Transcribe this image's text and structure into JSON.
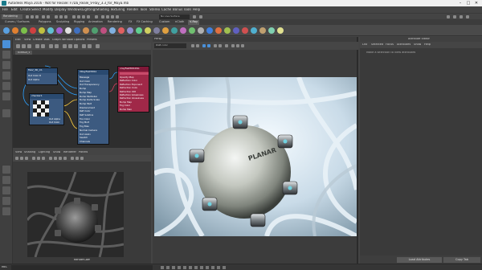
{
  "window": {
    "title": "Autodesk Maya 2016 - Not for Resale: F:/Da_Reale_V-Ray_3.3_for_Maya.mb"
  },
  "menubar": {
    "items": [
      "File",
      "Edit",
      "Create",
      "Select",
      "Modify",
      "Display",
      "Windows",
      "Lighting/Shading",
      "Texturing",
      "Render",
      "Toon",
      "Stereo",
      "Cache",
      "Bonus Tools",
      "Help"
    ]
  },
  "statusline": {
    "mode": "Rendering",
    "field": "No Live Surface"
  },
  "shelf": {
    "tabs": [
      "Curves / Surfaces",
      "Polygons",
      "Sculpting",
      "Rigging",
      "Animation",
      "Rendering",
      "FX",
      "FX Caching",
      "Custom",
      "nCloth",
      "V-Ray"
    ],
    "active_tab": "V-Ray",
    "icon_colors": [
      "#5aa0e0",
      "#e08030",
      "#7cc04a",
      "#d04040",
      "#c0c040",
      "#60c0d0",
      "#a060d0",
      "#e0e0e0",
      "#4070c0",
      "#d09050",
      "#50a070",
      "#c05080",
      "#80b0e0",
      "#e06060",
      "#9090d0",
      "#60d090",
      "#d0d060",
      "#8080a0",
      "#e0a040",
      "#40a0a0",
      "#c070c0",
      "#70c070",
      "#b0b0b0",
      "#4080e0",
      "#e07040",
      "#a0c050",
      "#6060c0",
      "#d05050",
      "#50b0d0",
      "#c0a070",
      "#80d0b0",
      "#e0e090"
    ]
  },
  "node_editor": {
    "menu": [
      "Edit",
      "View",
      "Create",
      "Tabs",
      "Graph",
      "Window",
      "Options",
      "Presets"
    ],
    "tab": "Untitled_1",
    "nodes": {
      "uv": {
        "title": "fileV_3D_C1",
        "rows": [
          "Out Color R",
          "Out Alpha"
        ],
        "color": "#4a7ab0"
      },
      "checker": {
        "title": "checker1",
        "rows": [
          "Out Alpha",
          "Out Color"
        ],
        "color": "#4a7ab0"
      },
      "vray_mtl": {
        "title": "VRayFastSSS1",
        "rows": [
          "Message",
          "Out Color",
          "Out Transparency",
          "Bump",
          "Bump Map",
          "Bump Multiplier",
          "Bump Delta Scale",
          "Bump Mult",
          "Displacement",
          "Refl Color",
          "Refl Subdivs",
          "Fog Color",
          "Fog Mult",
          "Fog Bias",
          "Normal Camera",
          "Out Apply",
          "Swatch",
          "Channels"
        ],
        "color": "#4a7ab0"
      },
      "sg": {
        "title": "vrayFastSSS1SG",
        "rows": [
          "Opacity Map",
          "Reflection Color",
          "Reflection Exponent",
          "Refraction Color",
          "Refraction IOR",
          "Reflection Glossiness",
          "Refraction Glossiness",
          "Bump Map",
          "Fog Color",
          "Bump Map"
        ],
        "color": "#b03050"
      }
    }
  },
  "render_view": {
    "menu": [
      "View",
      "Shading",
      "Lighting",
      "Show",
      "Renderer",
      "Panels"
    ],
    "caption": "RenderCam"
  },
  "viewport": {
    "title": "Persp",
    "camera": "RGB color"
  },
  "attribute_editor": {
    "title": "Attribute Editor",
    "tabs": [
      "List",
      "Selected",
      "Focus",
      "Attributes",
      "Show",
      "Help"
    ],
    "hint": "Make a selection to view attributes",
    "buttons": [
      "Load Attributes",
      "Copy Tab"
    ]
  },
  "bottombar": {
    "label": "MEL"
  },
  "render": {
    "brand": "PLANAR"
  }
}
